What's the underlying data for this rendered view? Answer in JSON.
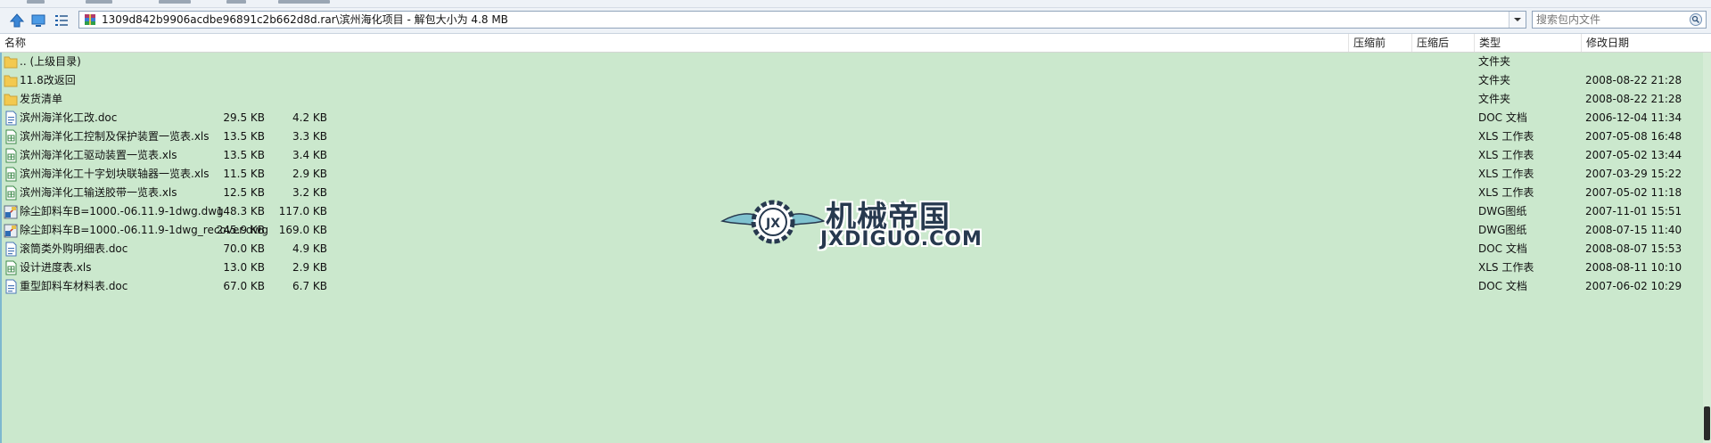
{
  "address": {
    "path": "1309d842b9906acdbe96891c2b662d8d.rar\\滨州海化项目 - 解包大小为 4.8 MB"
  },
  "search": {
    "placeholder": "搜索包内文件"
  },
  "columns": {
    "name": "名称",
    "packed": "压缩前",
    "unpacked": "压缩后",
    "type": "类型",
    "modified": "修改日期"
  },
  "files": [
    {
      "name": ".. (上级目录)",
      "packed": "",
      "unpacked": "",
      "type": "文件夹",
      "modified": "",
      "icon": "folder-icon"
    },
    {
      "name": "11.8改返回",
      "packed": "",
      "unpacked": "",
      "type": "文件夹",
      "modified": "2008-08-22 21:28",
      "icon": "folder-icon"
    },
    {
      "name": "发货清单",
      "packed": "",
      "unpacked": "",
      "type": "文件夹",
      "modified": "2008-08-22 21:28",
      "icon": "folder-icon"
    },
    {
      "name": "滨州海洋化工改.doc",
      "packed": "29.5 KB",
      "unpacked": "4.2 KB",
      "type": "DOC 文档",
      "modified": "2006-12-04 11:34",
      "icon": "doc-icon"
    },
    {
      "name": "滨州海洋化工控制及保护装置一览表.xls",
      "packed": "13.5 KB",
      "unpacked": "3.3 KB",
      "type": "XLS 工作表",
      "modified": "2007-05-08 16:48",
      "icon": "xls-icon"
    },
    {
      "name": "滨州海洋化工驱动装置一览表.xls",
      "packed": "13.5 KB",
      "unpacked": "3.4 KB",
      "type": "XLS 工作表",
      "modified": "2007-05-02 13:44",
      "icon": "xls-icon"
    },
    {
      "name": "滨州海洋化工十字划块联轴器一览表.xls",
      "packed": "11.5 KB",
      "unpacked": "2.9 KB",
      "type": "XLS 工作表",
      "modified": "2007-03-29 15:22",
      "icon": "xls-icon"
    },
    {
      "name": "滨州海洋化工输送胶带一览表.xls",
      "packed": "12.5 KB",
      "unpacked": "3.2 KB",
      "type": "XLS 工作表",
      "modified": "2007-05-02 11:18",
      "icon": "xls-icon"
    },
    {
      "name": "除尘卸料车B=1000.-06.11.9-1dwg.dwg",
      "packed": "148.3 KB",
      "unpacked": "117.0 KB",
      "type": "DWG图纸",
      "modified": "2007-11-01 15:51",
      "icon": "dwg-icon"
    },
    {
      "name": "除尘卸料车B=1000.-06.11.9-1dwg_recover.dwg",
      "packed": "245.9 KB",
      "unpacked": "169.0 KB",
      "type": "DWG图纸",
      "modified": "2008-07-15 11:40",
      "icon": "dwg-icon"
    },
    {
      "name": "滚筒类外购明细表.doc",
      "packed": "70.0 KB",
      "unpacked": "4.9 KB",
      "type": "DOC 文档",
      "modified": "2008-08-07 15:53",
      "icon": "doc-icon"
    },
    {
      "name": "设计进度表.xls",
      "packed": "13.0 KB",
      "unpacked": "2.9 KB",
      "type": "XLS 工作表",
      "modified": "2008-08-11 10:10",
      "icon": "xls-icon"
    },
    {
      "name": "重型卸料车材料表.doc",
      "packed": "67.0 KB",
      "unpacked": "6.7 KB",
      "type": "DOC 文档",
      "modified": "2007-06-02 10:29",
      "icon": "doc-icon"
    }
  ],
  "watermark": {
    "cn": "机械帝国",
    "en": "JXDIGUO.COM"
  },
  "colors": {
    "background": "#cbe8cd",
    "header": "#ffffff",
    "folder": "#f3c94f",
    "accent": "#3f8fd2"
  }
}
